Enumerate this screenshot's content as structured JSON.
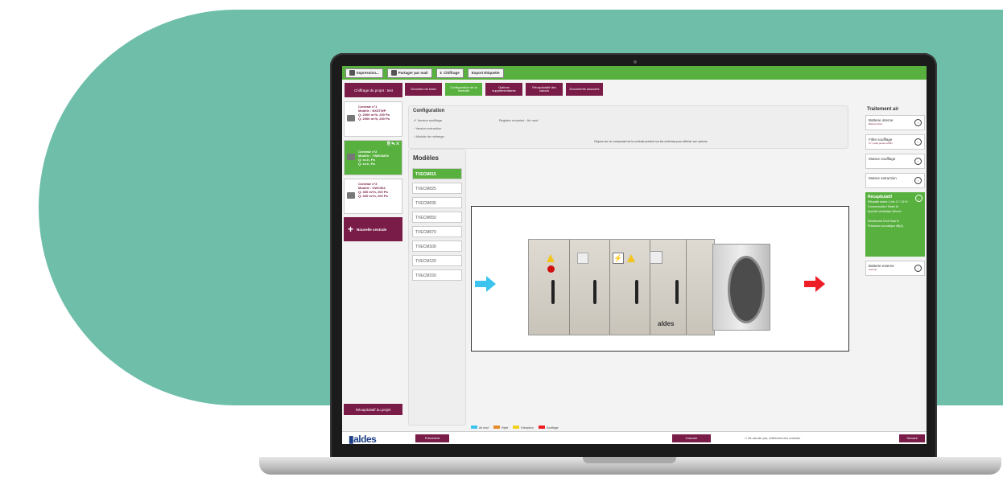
{
  "toolbar": {
    "items": [
      "Impression...",
      "Partager par mail",
      "Chiffrage",
      "Export Etiquette"
    ]
  },
  "project": {
    "title": "Chiffrage du projet : test"
  },
  "steps": [
    {
      "label": "Données de base"
    },
    {
      "label": "Configuration de la centrale"
    },
    {
      "label": "Options supplémentaires"
    },
    {
      "label": "Récapitulatif des calculs"
    },
    {
      "label": "Documents associés"
    }
  ],
  "centrales": [
    {
      "line1": "Centrale n°1",
      "line2": "Modèle : NXXTWP",
      "line3": "Q: 2000 m³/h, 200 Pa",
      "line4": "Q: 2000 m³/h, 200 Pa"
    },
    {
      "line1": "Centrale n°2",
      "line2": "Modèle : TWEIXM15",
      "line3": "Q: xx.h, Pa",
      "line4": "Q: xx.h, Pa"
    },
    {
      "line1": "Centrale n°3",
      "line2": "Modèle : CWC304",
      "line3": "Q: 300 m³/h, 200 Pa",
      "line4": "Q: 300 m³/h, 200 Pa"
    }
  ],
  "new_centrale": "Nouvelle centrale",
  "recap_projet": "Récapitulatif du projet",
  "config": {
    "title": "Configuration",
    "options": [
      "Version soufflage",
      "Version extraction",
      "Module de mélange"
    ],
    "registre": "Registre motorisé : Air neuf",
    "hint": "Cliquez sur un composant de la centrale présent sur les schémas pour afficher son options"
  },
  "models": {
    "title": "Modèles",
    "items": [
      "TVECM015",
      "TVECM025",
      "TVECM035",
      "TVECM050",
      "TVECM070",
      "TVECM100",
      "TVECM120",
      "TVECM150"
    ],
    "active_index": 0
  },
  "brand": "aldes",
  "legend": [
    "Air neuf",
    "Rejet",
    "Extraction",
    "Soufflage"
  ],
  "colors": {
    "teal": "#6ebeaa",
    "green": "#58b13f",
    "plum": "#7a1c48",
    "arrow_in": "#3cc3ee",
    "arrow_out": "#ee1c24"
  },
  "traitement": {
    "title": "Traitement air",
    "items": [
      {
        "label": "Batterie interne",
        "sub": "Batterie Elec."
      },
      {
        "label": "Filtre soufflage",
        "sub": "F7 (+sal) pertes ePM1"
      },
      {
        "label": "Moteur soufflage",
        "sub": ""
      },
      {
        "label": "Moteur extraction",
        "sub": ""
      }
    ],
    "recap": {
      "title": "Récapitulatif",
      "lines": [
        "Efficacité sèche / Lhiv  17 / 16   %",
        "Consommation Totale          W",
        "Spécific Ventilation      W/m³/h",
        "",
        "Rendement Droit Total         %",
        "Puissance acoustique        dB(A)"
      ]
    },
    "batterie_externe": {
      "label": "Batterie externe",
      "sub": "Aucune"
    }
  },
  "footer": {
    "logo": "aldes",
    "prev": "Précédent",
    "calc": "Calculer",
    "note": "Ne calculer pas, chiffrement des centrales",
    "next": "Suivant"
  }
}
